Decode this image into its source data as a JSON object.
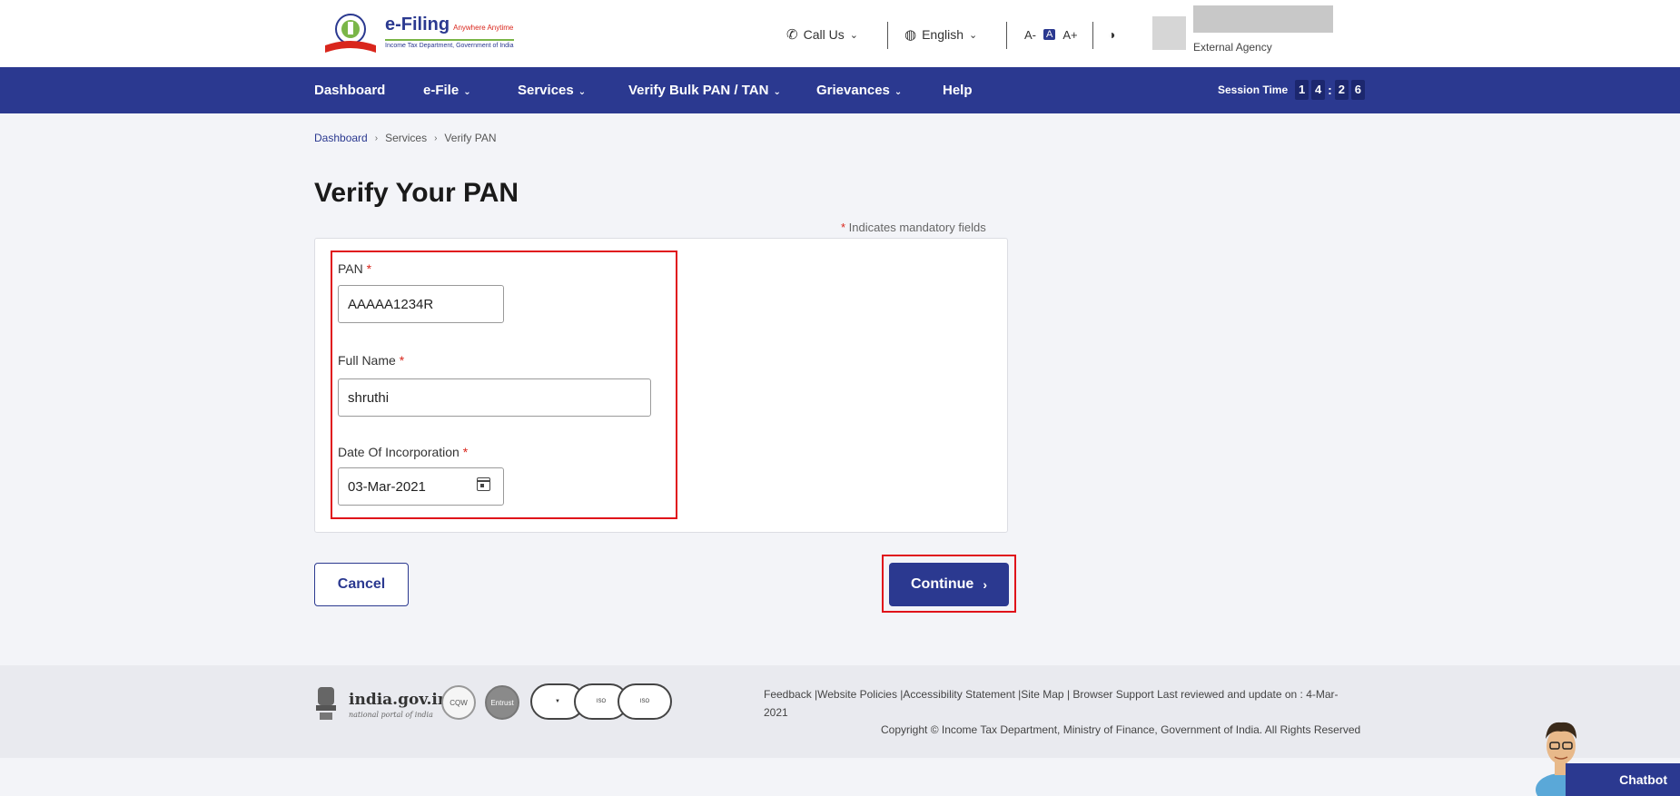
{
  "header": {
    "brand": "e-Filing",
    "brand_tagline": "Anywhere Anytime",
    "brand_sub": "Income Tax Department, Government of India",
    "call_us": "Call Us",
    "language": "English",
    "font_decrease": "A-",
    "font_normal": "A",
    "font_increase": "A+",
    "user_role": "External Agency"
  },
  "nav": {
    "items": [
      {
        "label": "Dashboard",
        "dropdown": false
      },
      {
        "label": "e-File",
        "dropdown": true
      },
      {
        "label": "Services",
        "dropdown": true
      },
      {
        "label": "Verify Bulk PAN / TAN",
        "dropdown": true
      },
      {
        "label": "Grievances",
        "dropdown": true
      },
      {
        "label": "Help",
        "dropdown": false
      }
    ],
    "session_label": "Session Time",
    "session_digits": [
      "1",
      "4",
      "2",
      "6"
    ]
  },
  "breadcrumb": [
    "Dashboard",
    "Services",
    "Verify PAN"
  ],
  "page": {
    "title": "Verify Your PAN",
    "mandatory_note": "Indicates mandatory fields"
  },
  "form": {
    "pan_label": "PAN",
    "pan_value": "AAAAA1234R",
    "name_label": "Full Name",
    "name_value": "shruthi",
    "doi_label": "Date Of Incorporation",
    "doi_value": "03-Mar-2021"
  },
  "buttons": {
    "cancel": "Cancel",
    "continue": "Continue"
  },
  "footer": {
    "gov_text": "india.gov.in",
    "gov_sub": "national portal of india",
    "links": "Feedback |Website Policies |Accessibility Statement |Site Map | Browser Support   Last reviewed and update on : 4-Mar-2021",
    "copyright": "Copyright © Income Tax Department, Ministry of Finance, Government of India. All Rights Reserved"
  },
  "chatbot": {
    "label": "Chatbot"
  },
  "colors": {
    "primary": "#2b3990",
    "highlight": "#e0121a",
    "page_bg": "#f3f4f8"
  }
}
